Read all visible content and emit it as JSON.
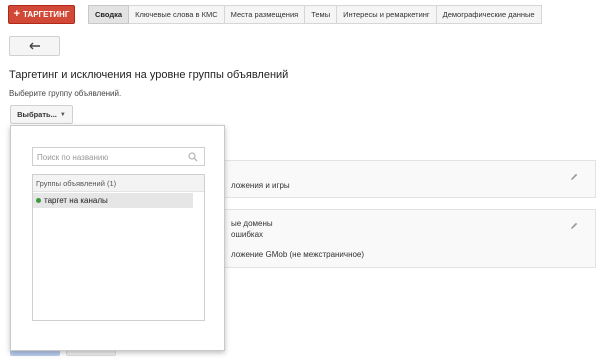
{
  "toolbar": {
    "targeting_button": {
      "icon": "plus-icon",
      "label": "ТАРГЕТИНГ",
      "color": "#d14836"
    },
    "tabs": [
      {
        "label": "Сводка",
        "active": true
      },
      {
        "label": "Ключевые слова в КМС",
        "active": false
      },
      {
        "label": "Места размещения",
        "active": false
      },
      {
        "label": "Темы",
        "active": false
      },
      {
        "label": "Интересы и ремаркетинг",
        "active": false
      },
      {
        "label": "Демографические данные",
        "active": false
      }
    ],
    "back_button_icon": "arrow-left-icon"
  },
  "main": {
    "title": "Таргетинг и исключения на уровне группы объявлений",
    "subtitle": "Выберите группу объявлений.",
    "select_button_label": "Выбрать..."
  },
  "popup": {
    "search_placeholder": "Поиск по названию",
    "search_value": "",
    "list_header": "Группы объявлений (1)",
    "items": [
      {
        "label": "таргет на каналы",
        "status_color": "#3c9b3c"
      }
    ]
  },
  "cards": [
    {
      "lines": [
        "ложения и игры"
      ],
      "edit_icon": "pencil-icon"
    },
    {
      "lines": [
        "ые домены",
        "ошибках",
        "ложение GMob (не межстраничное)"
      ],
      "edit_icon": "pencil-icon"
    }
  ]
}
